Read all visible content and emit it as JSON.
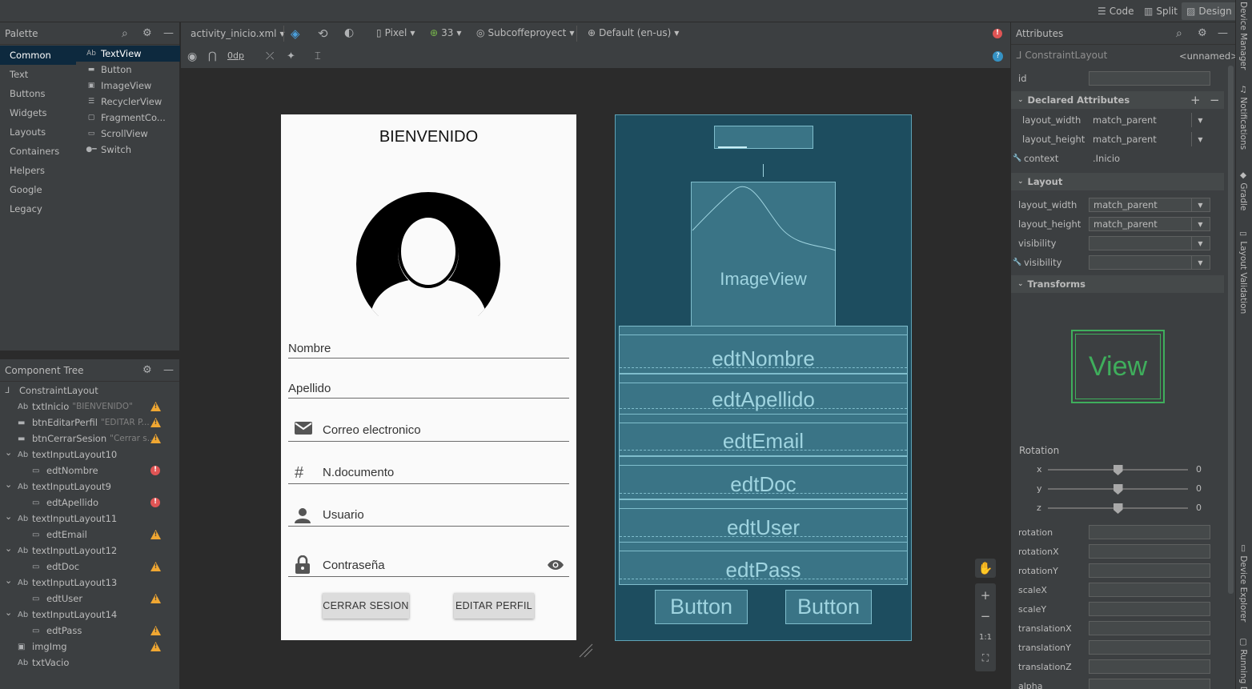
{
  "top_bar": {
    "modes": [
      {
        "label": "Code",
        "icon": "code-lines-icon"
      },
      {
        "label": "Split",
        "icon": "split-icon"
      },
      {
        "label": "Design",
        "icon": "design-image-icon"
      }
    ],
    "selected_mode": "Design"
  },
  "palette": {
    "title": "Palette",
    "categories": [
      "Common",
      "Text",
      "Buttons",
      "Widgets",
      "Layouts",
      "Containers",
      "Helpers",
      "Google",
      "Legacy"
    ],
    "selected_category": "Common",
    "widgets": [
      {
        "icon_text": "Ab",
        "label": "TextView"
      },
      {
        "icon_text": "▬",
        "label": "Button"
      },
      {
        "icon_text": "▣",
        "label": "ImageView"
      },
      {
        "icon_text": "☰",
        "label": "RecyclerView"
      },
      {
        "icon_text": "▢",
        "label": "FragmentCo..."
      },
      {
        "icon_text": "▭",
        "label": "ScrollView"
      },
      {
        "icon_text": "●━",
        "label": "Switch"
      }
    ],
    "selected_widget": "TextView"
  },
  "component_tree": {
    "title": "Component Tree",
    "nodes": [
      {
        "label": "ConstraintLayout",
        "hint": "",
        "icon": "ᒧ",
        "status": ""
      },
      {
        "label": "txtInicio",
        "hint": "\"BIENVENIDO\"",
        "icon": "Ab",
        "status": "warn"
      },
      {
        "label": "btnEditarPerfil",
        "hint": "\"EDITAR P...",
        "icon": "▬",
        "status": "warn"
      },
      {
        "label": "btnCerrarSesion",
        "hint": "\"Cerrar s...",
        "icon": "▬",
        "status": "warn"
      },
      {
        "label": "textInputLayout10",
        "hint": "",
        "icon": "Ab",
        "status": "",
        "expanded": true
      },
      {
        "label": "edtNombre",
        "hint": "",
        "icon": "▭",
        "status": "error"
      },
      {
        "label": "textInputLayout9",
        "hint": "",
        "icon": "Ab",
        "status": "",
        "expanded": true
      },
      {
        "label": "edtApellido",
        "hint": "",
        "icon": "▭",
        "status": "error"
      },
      {
        "label": "textInputLayout11",
        "hint": "",
        "icon": "Ab",
        "status": "",
        "expanded": true
      },
      {
        "label": "edtEmail",
        "hint": "",
        "icon": "▭",
        "status": "warn"
      },
      {
        "label": "textInputLayout12",
        "hint": "",
        "icon": "Ab",
        "status": "",
        "expanded": true
      },
      {
        "label": "edtDoc",
        "hint": "",
        "icon": "▭",
        "status": "warn"
      },
      {
        "label": "textInputLayout13",
        "hint": "",
        "icon": "Ab",
        "status": "",
        "expanded": true
      },
      {
        "label": "edtUser",
        "hint": "",
        "icon": "▭",
        "status": "warn"
      },
      {
        "label": "textInputLayout14",
        "hint": "",
        "icon": "Ab",
        "status": "",
        "expanded": true
      },
      {
        "label": "edtPass",
        "hint": "",
        "icon": "▭",
        "status": "warn"
      },
      {
        "label": "imgImg",
        "hint": "",
        "icon": "▣",
        "status": "warn"
      },
      {
        "label": "txtVacio",
        "hint": "",
        "icon": "Ab",
        "status": ""
      }
    ]
  },
  "editor_toolbar": {
    "file": "activity_inicio.xml",
    "device": "Pixel",
    "api": "33",
    "theme": "Subcoffeproyect",
    "locale": "Default (en-us)",
    "margin": "0dp"
  },
  "design_preview": {
    "title": "BIENVENIDO",
    "fields": [
      "Nombre",
      "Apellido",
      "Correo electronico",
      "N.documento",
      "Usuario",
      "Contraseña"
    ],
    "buttons": [
      "CERRAR SESION",
      "EDITAR PERFIL"
    ]
  },
  "blueprint": {
    "image_label": "ImageView",
    "fields": [
      "edtNombre",
      "edtApellido",
      "edtEmail",
      "edtDoc",
      "edtUser",
      "edtPass"
    ],
    "buttons": [
      "Button",
      "Button"
    ]
  },
  "zoom_controls": [
    "+",
    "−",
    "1:1"
  ],
  "attributes": {
    "title": "Attributes",
    "component": "ConstraintLayout",
    "component_name": "<unnamed>",
    "id_label": "id",
    "id_value": "",
    "declared_section": "Declared Attributes",
    "declared": [
      {
        "label": "layout_width",
        "value": "match_parent"
      },
      {
        "label": "layout_height",
        "value": "match_parent"
      },
      {
        "label": "context",
        "value": ".Inicio"
      }
    ],
    "layout_section": "Layout",
    "layout": [
      {
        "label": "layout_width",
        "value": "match_parent"
      },
      {
        "label": "layout_height",
        "value": "match_parent"
      },
      {
        "label": "visibility",
        "value": ""
      },
      {
        "label": "visibility",
        "value": ""
      }
    ],
    "transforms_section": "Transforms",
    "view_preview_label": "View",
    "rotation_title": "Rotation",
    "rotation_axes": [
      {
        "axis": "x",
        "value": "0",
        "level": 0.5
      },
      {
        "axis": "y",
        "value": "0",
        "level": 0.5
      },
      {
        "axis": "z",
        "value": "0",
        "level": 0.5
      }
    ],
    "transform_fields": [
      "rotation",
      "rotationX",
      "rotationY",
      "scaleX",
      "scaleY",
      "translationX",
      "translationY",
      "translationZ",
      "alpha"
    ]
  },
  "right_strip": [
    "Device Manager",
    "Notifications",
    "Gradle",
    "Layout Validation",
    "Device Explorer",
    "Running D"
  ]
}
